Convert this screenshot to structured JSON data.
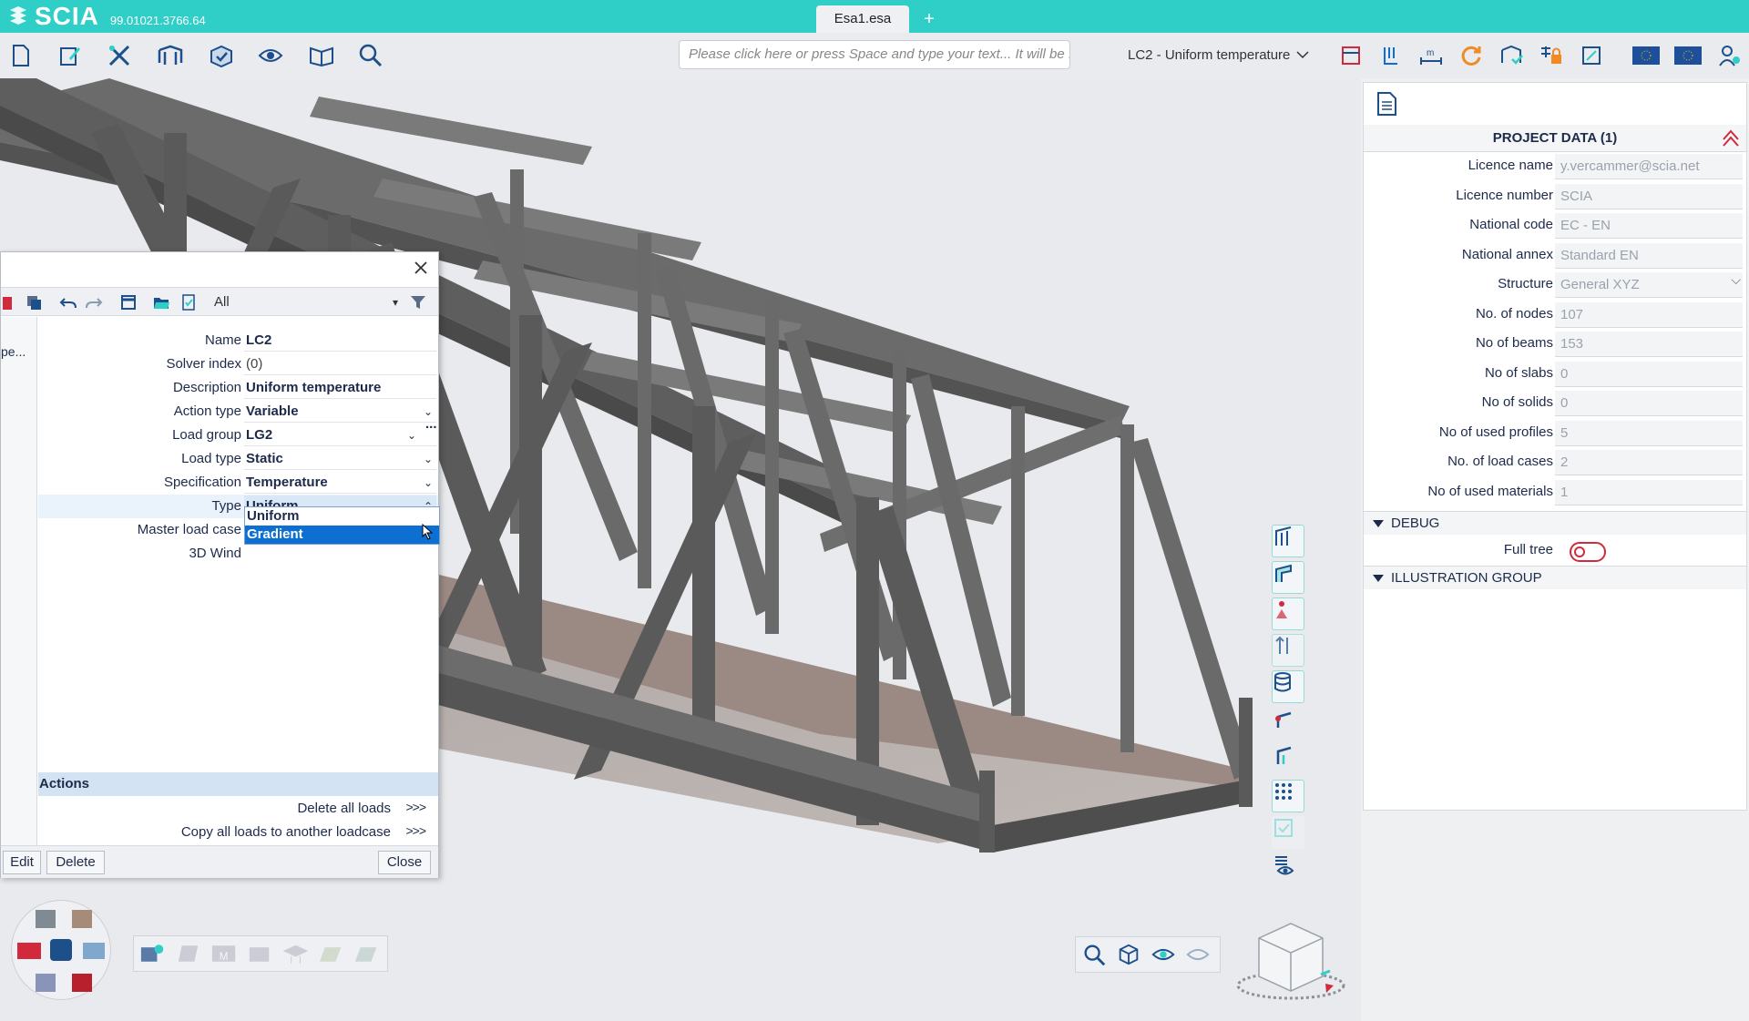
{
  "app": {
    "brand": "SCIA",
    "version": "99.01021.3766.64",
    "tab": "Esa1.esa",
    "new_tab": "+"
  },
  "toolbar": {
    "command_placeholder": "Please click here or press Space and type your text... It will be ...",
    "load_case": "LC2 - Uniform temperature",
    "icons": [
      "new-file-icon",
      "edit-icon",
      "tools-icon",
      "structure-icon",
      "check-icon",
      "view-icon",
      "open-book-icon",
      "search-help-icon"
    ]
  },
  "dialog": {
    "filter": "All",
    "left_col_text": "pe...",
    "fields": [
      {
        "label": "Name",
        "value": "LC2",
        "plain": false,
        "dropdown": false
      },
      {
        "label": "Solver index",
        "value": "(0)",
        "plain": true,
        "dropdown": false
      },
      {
        "label": "Description",
        "value": "Uniform temperature",
        "plain": false,
        "dropdown": false
      },
      {
        "label": "Action type",
        "value": "Variable",
        "plain": false,
        "dropdown": true
      },
      {
        "label": "Load group",
        "value": "LG2",
        "plain": false,
        "dropdown": true
      },
      {
        "label": "Load type",
        "value": "Static",
        "plain": false,
        "dropdown": true
      },
      {
        "label": "Specification",
        "value": "Temperature",
        "plain": false,
        "dropdown": true
      },
      {
        "label": "Type",
        "value": "Uniform",
        "plain": false,
        "dropdown": true
      },
      {
        "label": "Master load case",
        "value": "",
        "plain": false,
        "dropdown": false
      },
      {
        "label": "3D Wind",
        "value": "",
        "plain": false,
        "dropdown": false
      }
    ],
    "type_options": [
      "Uniform",
      "Gradient"
    ],
    "type_selected_highlight": "Gradient",
    "actions_title": "Actions",
    "actions": [
      {
        "label": "Delete all loads",
        "go": ">>>"
      },
      {
        "label": "Copy all loads to another loadcase",
        "go": ">>>"
      }
    ],
    "buttons": {
      "edit": "Edit",
      "delete": "Delete",
      "close": "Close"
    },
    "load_group_more": "..."
  },
  "project_data": {
    "title": "PROJECT DATA (1)",
    "rows": [
      {
        "label": "Licence name",
        "value": "y.vercammer@scia.net"
      },
      {
        "label": "Licence number",
        "value": "SCIA"
      },
      {
        "label": "National code",
        "value": "EC - EN"
      },
      {
        "label": "National annex",
        "value": "Standard EN"
      },
      {
        "label": "Structure",
        "value": "General XYZ"
      },
      {
        "label": "No. of nodes",
        "value": "107"
      },
      {
        "label": "No of beams",
        "value": "153"
      },
      {
        "label": "No of slabs",
        "value": "0"
      },
      {
        "label": "No of solids",
        "value": "0"
      },
      {
        "label": "No of used profiles",
        "value": "5"
      },
      {
        "label": "No. of load cases",
        "value": "2"
      },
      {
        "label": "No of used materials",
        "value": "1"
      }
    ],
    "debug_title": "DEBUG",
    "full_tree_label": "Full tree",
    "full_tree_on": false,
    "illustration_title": "ILLUSTRATION GROUP"
  },
  "colors": {
    "brand": "#2fcfc7",
    "toggle": "#d02a3c",
    "selection": "#0d6fd1"
  }
}
